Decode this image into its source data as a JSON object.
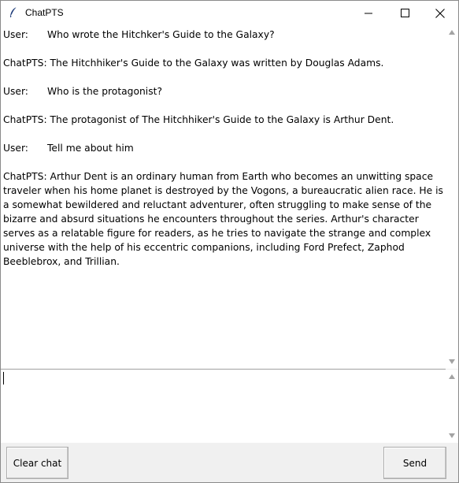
{
  "window": {
    "title": "ChatPTS",
    "icon": "feather-icon"
  },
  "chat": {
    "messages": [
      {
        "speaker": "User:",
        "text": "Who wrote the Hitchker's Guide to the Galaxy?"
      },
      {
        "speaker": "ChatPTS:",
        "text": "The Hitchhiker's Guide to the Galaxy was written by Douglas Adams."
      },
      {
        "speaker": "User:",
        "text": "Who is the protagonist?"
      },
      {
        "speaker": "ChatPTS:",
        "text": "The protagonist of The Hitchhiker's Guide to the Galaxy is Arthur Dent."
      },
      {
        "speaker": "User:",
        "text": "Tell me about him"
      },
      {
        "speaker": "ChatPTS:",
        "text": "Arthur Dent is an ordinary human from Earth who becomes an unwitting space traveler when his home planet is destroyed by the Vogons, a bureaucratic alien race. He is a somewhat bewildered and reluctant adventurer, often struggling to make sense of the bizarre and absurd situations he encounters throughout the series. Arthur's character serves as a relatable figure for readers, as he tries to navigate the strange and complex universe with the help of his eccentric companions, including Ford Prefect, Zaphod Beeblebrox, and Trillian."
      }
    ]
  },
  "input": {
    "value": ""
  },
  "buttons": {
    "clear_label": "Clear chat",
    "send_label": "Send"
  }
}
